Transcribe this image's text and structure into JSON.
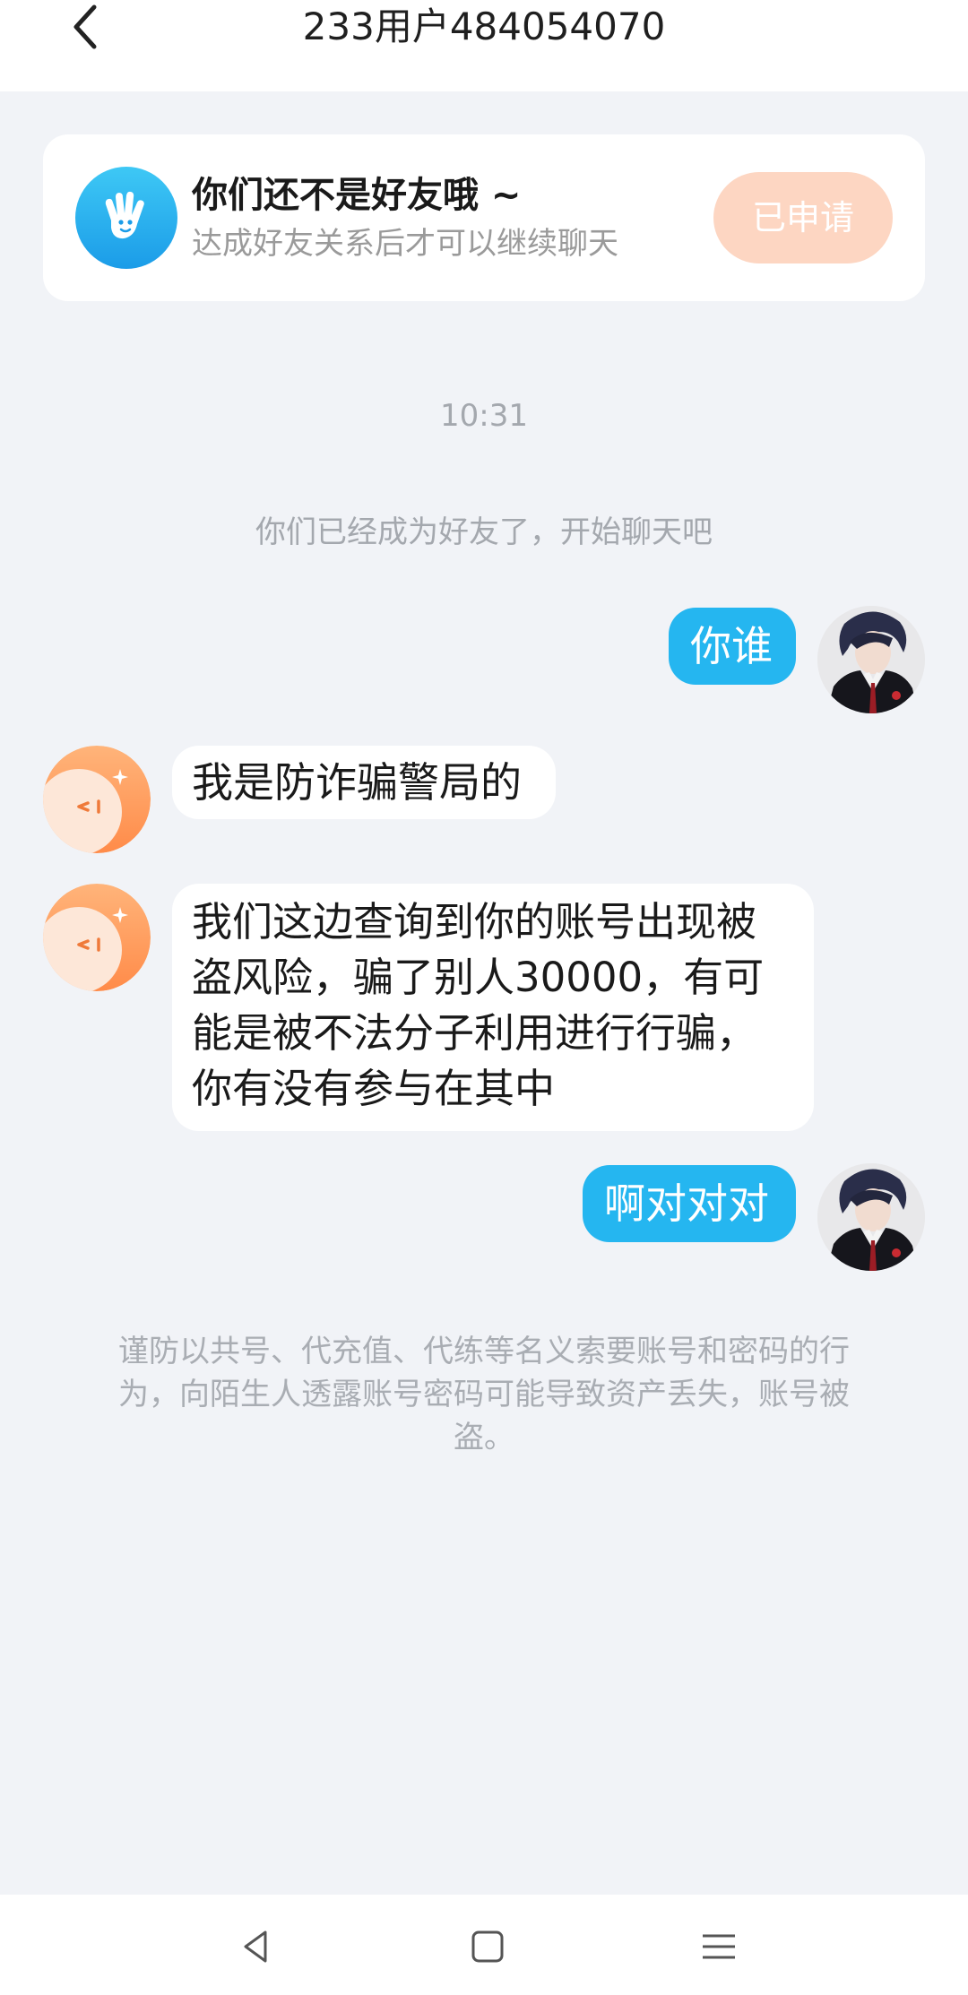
{
  "header": {
    "title": "233用户484054070",
    "back_icon": "chevron-left-icon"
  },
  "notice": {
    "title": "你们还不是好友哦 ~",
    "subtitle": "达成好友关系后才可以继续聊天",
    "button_label": "已申请",
    "button_color": "#fdd6c2",
    "icon": "waving-hand-icon"
  },
  "chat": {
    "time": "10:31",
    "system_message": "你们已经成为好友了，开始聊天吧",
    "messages": [
      {
        "direction": "out",
        "text": "你谁"
      },
      {
        "direction": "in",
        "text": "我是防诈骗警局的"
      },
      {
        "direction": "in",
        "lines": [
          "我们这边查询到你的账号出现被",
          "盗风险，骗了别人30000，有可",
          "能是被不法分子利用进行行骗，",
          "你有没有参与在其中"
        ]
      },
      {
        "direction": "out",
        "text": "啊对对对"
      }
    ],
    "disclaimer_lines": [
      "谨防以共号、代充值、代练等名义索要账号和密码的行",
      "为，向陌生人透露账号密码可能导致资产丢失，账号被",
      "盗。"
    ]
  },
  "colors": {
    "outgoing_bubble": "#25b6f0",
    "incoming_bubble": "#ffffff",
    "background": "#f1f3f7"
  },
  "navbar": {
    "back_icon": "triangle-back-icon",
    "home_icon": "square-home-icon",
    "menu_icon": "menu-lines-icon"
  }
}
